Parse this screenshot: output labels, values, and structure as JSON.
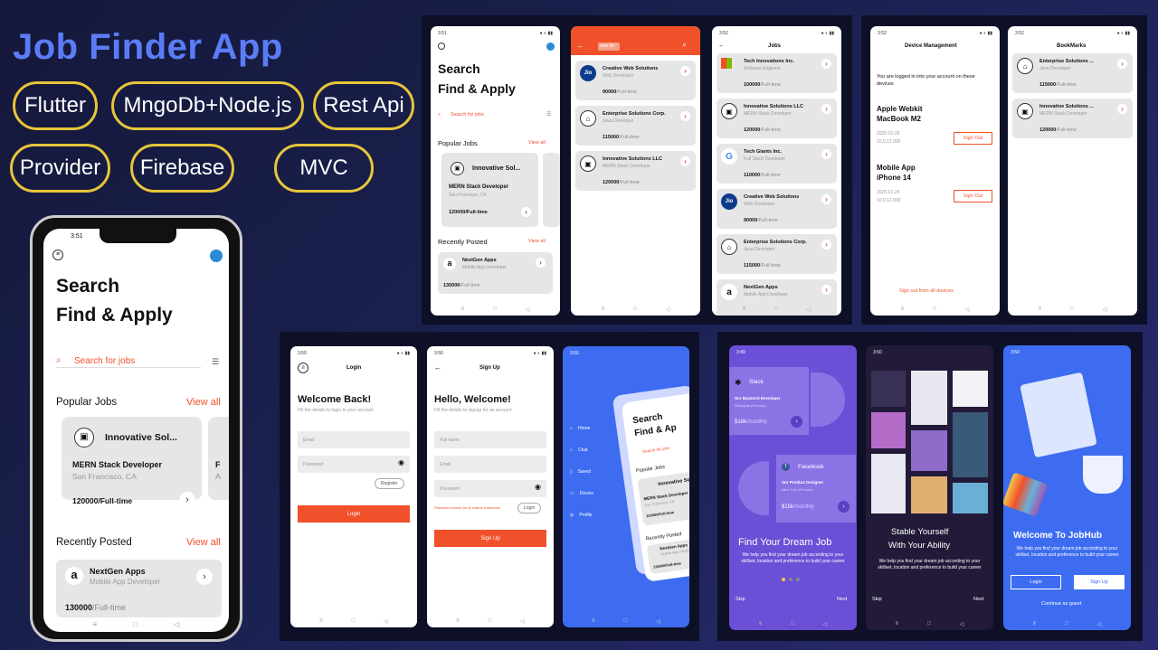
{
  "title": "Job Finder App",
  "tags": [
    "Flutter",
    "MngoDb+Node.js",
    "Rest Api",
    "Provider",
    "Firebase",
    "MVC"
  ],
  "colors": {
    "accent": "#f0502a",
    "title": "#5b7cf6",
    "pill_border": "#e7c53a",
    "panel": "#0e1027",
    "blue": "#3d6cf0",
    "purple": "#6b4fd6"
  },
  "phone": {
    "time": "3:51",
    "heading1": "Search",
    "heading2": "Find & Apply",
    "search_placeholder": "Search for jobs",
    "popular_label": "Popular Jobs",
    "view_all": "View all",
    "recent_label": "Recently Posted",
    "popular": {
      "company": "Innovative Sol...",
      "role": "MERN Stack Developer",
      "location": "San Francisco, CA",
      "salary": "120000/Full-time",
      "peek_a": "F",
      "peek_b": "A"
    },
    "recent": {
      "company": "NextGen Apps",
      "role": "Mobile App Developer",
      "salary": "130000",
      "period": "/Full-time"
    }
  },
  "p1": {
    "time": "3:51",
    "heading1": "Search",
    "heading2": "Find & Apply",
    "search_placeholder": "Search for jobs",
    "popular_label": "Popular Jobs",
    "view_all": "View all",
    "recent_label": "Recently Posted",
    "popular": {
      "company": "Innovative Sol...",
      "role": "MERN Stack Developer",
      "location": "San Francisco, CA",
      "salary": "120000/Full-time"
    },
    "recent": {
      "company": "NextGen Apps",
      "role": "Mobile App Developer",
      "salary": "130000",
      "period": "/Full-time"
    }
  },
  "p2": {
    "search_value": "web de",
    "items": [
      {
        "logo": "Jio",
        "company": "Creative Web Solutions",
        "role": "Web Developer",
        "salary": "90000",
        "period": "/Full-time"
      },
      {
        "logo": "⌂",
        "company": "Enterprise Solutions Corp.",
        "role": "Java Developer",
        "salary": "115000",
        "period": "/Full-time"
      },
      {
        "logo": "▣",
        "company": "Innovative Solutions LLC",
        "role": "MERN Stack Developer",
        "salary": "120000",
        "period": "/Full-time"
      }
    ]
  },
  "p3": {
    "time": "3:52",
    "title": "Jobs",
    "items": [
      {
        "logo": "ms",
        "company": "Tech Innovations Inc.",
        "role": "Software Engineer",
        "salary": "100000",
        "period": "/Full-time"
      },
      {
        "logo": "▣",
        "company": "Innovative Solutions LLC",
        "role": "MERN Stack Developer",
        "salary": "120000",
        "period": "/Full-time"
      },
      {
        "logo": "G",
        "company": "Tech Giants Inc.",
        "role": "Full Stack Developer",
        "salary": "110000",
        "period": "/Full-time"
      },
      {
        "logo": "Jio",
        "company": "Creative Web Solutions",
        "role": "Web Developer",
        "salary": "90000",
        "period": "/Full-time"
      },
      {
        "logo": "⌂",
        "company": "Enterprise Solutions Corp.",
        "role": "Java Developer",
        "salary": "115000",
        "period": "/Full-time"
      },
      {
        "logo": "a",
        "company": "NextGen Apps",
        "role": "Mobile App Developer",
        "salary": "",
        "period": ""
      }
    ]
  },
  "p4": {
    "time": "3:52",
    "title": "Device Management",
    "intro": "You are logged in into your account on these devices",
    "devices": [
      {
        "name1": "Apple Webkit",
        "name2": "MacBook M2",
        "date": "2025-01-25",
        "ip": "10.0.12.000",
        "action": "Sign Out"
      },
      {
        "name1": "Mobile App",
        "name2": "iPhone 14",
        "date": "2025-01-25",
        "ip": "10.0.12.000",
        "action": "Sign Out"
      }
    ],
    "signout_all": "Sign out from all devices"
  },
  "p5": {
    "time": "3:52",
    "title": "BookMarks",
    "items": [
      {
        "logo": "⌂",
        "company": "Enterprise Solutions ...",
        "role": "Java Developer",
        "salary": "115000",
        "period": "/Full-time"
      },
      {
        "logo": "▣",
        "company": "Innovative Solutions ...",
        "role": "MERN Stack Developer",
        "salary": "120000",
        "period": "/Full-time"
      }
    ]
  },
  "login": {
    "time": "3:50",
    "title": "Login",
    "welcome": "Welcome Back!",
    "sub": "Fill the details to login to your account",
    "email": "Email",
    "password": "Password",
    "register": "Register",
    "button": "Login"
  },
  "signup": {
    "time": "3:50",
    "title": "Sign Up",
    "welcome": "Hello, Welcome!",
    "sub": "Fill the details to signup for an account",
    "fullname": "Full name",
    "email": "Email",
    "password": "Password",
    "hint": "Password should be at least 8 characters",
    "login": "Login",
    "button": "Sign Up"
  },
  "drawer": {
    "time": "3:50",
    "items": [
      "Home",
      "Chat",
      "Saved",
      "Device",
      "Profile"
    ],
    "preview_h1": "Search",
    "preview_h2": "Find & Ap",
    "preview_search": "Search for jobs",
    "preview_popular": "Popular Jobs",
    "preview_company": "Innovative So",
    "preview_role": "MERN Stack Developer",
    "preview_loc": "San Francisco, CA",
    "preview_salary": "120000/Full-time",
    "preview_recent": "Recently Posted",
    "preview_rcompany": "NextGen Apps",
    "preview_rrole": "Mobile App Developer",
    "preview_rsalary": "130000/Full-time"
  },
  "ob1": {
    "time": "3:49",
    "card1": {
      "company": "Slack",
      "role": "Snr Backend Developer",
      "loc": "Shanghai (Remote)",
      "salary": "$18k",
      "period": "/monthly"
    },
    "card2": {
      "company": "Facebook",
      "role": "Snr Product Designer",
      "loc": "New York (Remote)",
      "salary": "$15k",
      "period": "/monthly"
    },
    "title": "Find Your Dream Job",
    "desc": "We help you find your dream job according to your skillset, location and preference to build your career",
    "skip": "Skip",
    "next": "Next"
  },
  "ob2": {
    "time": "3:50",
    "title1": "Stable Yourself",
    "title2": "With Your Ability",
    "desc": "We help you find your dream job according to your skillset, location and preference to build your career",
    "skip": "Skip",
    "next": "Next"
  },
  "ob3": {
    "time": "3:50",
    "title": "Welcome To JobHub",
    "desc": "We help you find your dream job according to your skillset, location and preference to build your career",
    "login": "Login",
    "signup": "Sign Up",
    "guest": "Continue as guest"
  }
}
